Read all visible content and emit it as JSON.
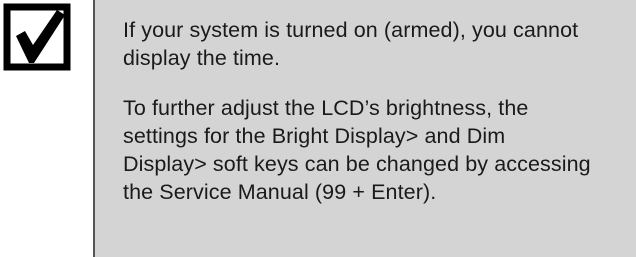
{
  "note": {
    "icon": "checkbox-checked-icon",
    "paragraphs": [
      "If your system is turned on (armed), you cannot display the time.",
      "To further adjust the LCD’s brightness, the settings for the Bright Display> and Dim Display> soft keys can be changed by accessing the Service Manual (99 + Enter)."
    ],
    "colors": {
      "panel_background": "#d4d4d4",
      "icon_color": "#000000",
      "text_color": "#1a1a1a"
    }
  }
}
